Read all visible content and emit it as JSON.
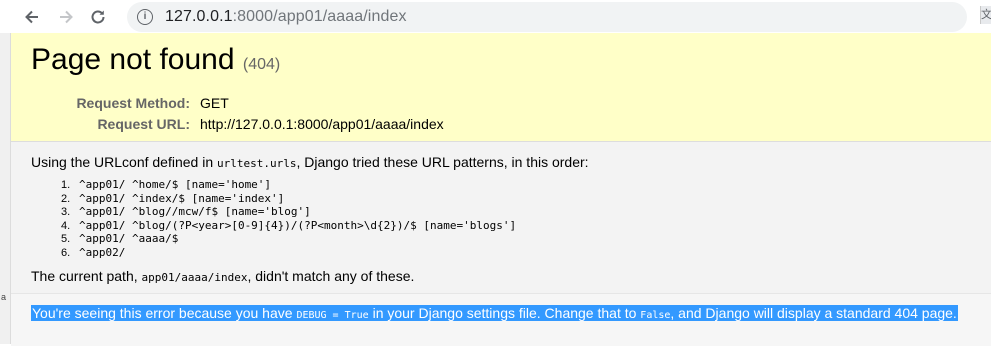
{
  "browser": {
    "url_host": "127.0.0.1",
    "url_rest": ":8000/app01/aaaa/index",
    "back_icon": "back-arrow-icon",
    "forward_icon": "forward-arrow-icon",
    "reload_icon": "reload-icon"
  },
  "edge": {
    "char": "a"
  },
  "summary": {
    "title": "Page not found",
    "code": "(404)",
    "request_method_label": "Request Method:",
    "request_method": "GET",
    "request_url_label": "Request URL:",
    "request_url": "http://127.0.0.1:8000/app01/aaaa/index"
  },
  "info": {
    "intro_before": "Using the URLconf defined in ",
    "urlconf": "urltest.urls",
    "intro_after": ", Django tried these URL patterns, in this order:",
    "patterns": [
      {
        "num": "1.",
        "text": "^app01/ ^home/$ [name='home']"
      },
      {
        "num": "2.",
        "text": "^app01/ ^index/$ [name='index']"
      },
      {
        "num": "3.",
        "text": "^app01/ ^blog//mcw/f$ [name='blog']"
      },
      {
        "num": "4.",
        "text": "^app01/ ^blog/(?P<year>[0-9]{4})/(?P<month>\\d{2})/$ [name='blogs']"
      },
      {
        "num": "5.",
        "text": "^app01/ ^aaaa/$"
      },
      {
        "num": "6.",
        "text": "^app02/"
      }
    ],
    "outro_before": "The current path, ",
    "current_path": "app01/aaaa/index",
    "outro_after": ", didn't match any of these."
  },
  "explanation": {
    "before": "You're seeing this error because you have ",
    "debug_code": "DEBUG = True",
    "middle": " in your Django settings file. Change that to ",
    "false_code": "False",
    "after": ", and Django will display a standard 404 page."
  }
}
